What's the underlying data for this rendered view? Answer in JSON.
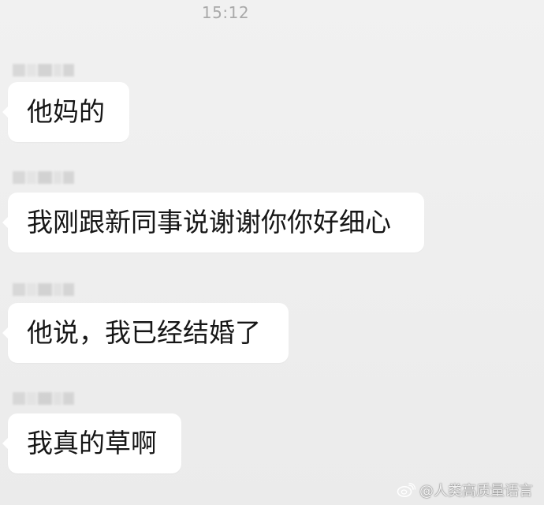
{
  "status": {
    "time": "15:12"
  },
  "messages": [
    {
      "text": "他妈的"
    },
    {
      "text": "我刚跟新同事说谢谢你你好细心"
    },
    {
      "text": "他说，我已经结婚了"
    },
    {
      "text": "我真的草啊"
    }
  ],
  "watermark": {
    "text": "@人类高质量语言",
    "icon": "weibo-icon"
  }
}
